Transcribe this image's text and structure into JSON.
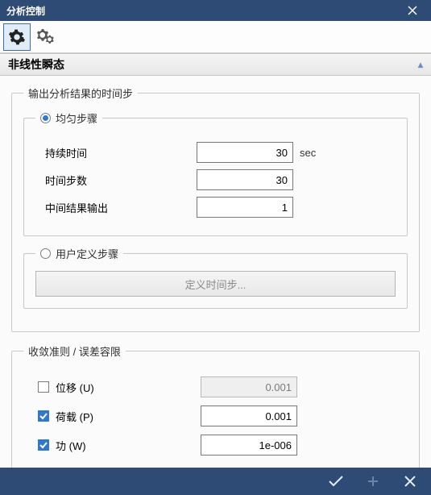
{
  "window": {
    "title": "分析控制"
  },
  "section": {
    "title": "非线性瞬态"
  },
  "outputGroup": {
    "legend": "输出分析结果的时间步",
    "uniform": {
      "radio_label": "均匀步骤",
      "checked": true,
      "duration": {
        "label": "持续时间",
        "value": "30",
        "unit": "sec"
      },
      "steps": {
        "label": "时间步数",
        "value": "30"
      },
      "interm": {
        "label": "中间结果输出",
        "value": "1"
      }
    },
    "user": {
      "radio_label": "用户定义步骤",
      "checked": false,
      "button_label": "定义时间步..."
    }
  },
  "convGroup": {
    "legend": "收敛准则 / 误差容限",
    "disp": {
      "label": "位移 (U)",
      "checked": false,
      "value": "0.001"
    },
    "load": {
      "label": "荷载 (P)",
      "checked": true,
      "value": "0.001"
    },
    "work": {
      "label": "功 (W)",
      "checked": true,
      "value": "1e-006"
    }
  },
  "icons": {
    "gear_single": "gear-icon",
    "gear_double": "double-gear-icon",
    "chevron": "▴"
  }
}
